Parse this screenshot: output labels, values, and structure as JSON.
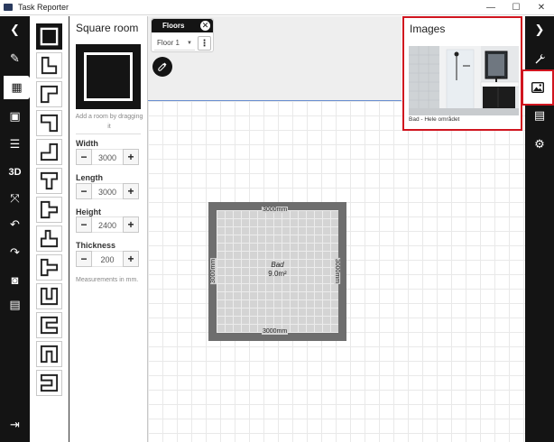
{
  "window": {
    "title": "Task Reporter",
    "controls": {
      "minimize": "—",
      "maximize": "☐",
      "close": "✕"
    }
  },
  "left_rail": {
    "items": [
      {
        "name": "back",
        "icon": "chevron-left-icon",
        "glyph": "❮"
      },
      {
        "name": "draw",
        "icon": "pencil-icon",
        "glyph": "✎"
      },
      {
        "name": "rooms",
        "icon": "grid-icon",
        "glyph": "▦",
        "active": true
      },
      {
        "name": "objects",
        "icon": "box-icon",
        "glyph": "▣"
      },
      {
        "name": "list",
        "icon": "list-icon",
        "glyph": "☰"
      },
      {
        "name": "view-3d",
        "label": "3D"
      },
      {
        "name": "fit",
        "icon": "expand-icon",
        "glyph": "⤧"
      },
      {
        "name": "undo",
        "icon": "undo-icon",
        "glyph": "↶"
      },
      {
        "name": "redo",
        "icon": "redo-icon",
        "glyph": "↷"
      },
      {
        "name": "snapshot",
        "icon": "camera-icon",
        "glyph": "◙"
      },
      {
        "name": "save",
        "icon": "save-icon",
        "glyph": "▤"
      },
      {
        "name": "exit",
        "icon": "exit-icon",
        "glyph": "⇥"
      }
    ]
  },
  "properties": {
    "title": "Square room",
    "drag_hint": "Add a room by dragging it",
    "fields": [
      {
        "label": "Width",
        "value": "3000"
      },
      {
        "label": "Length",
        "value": "3000"
      },
      {
        "label": "Height",
        "value": "2400"
      },
      {
        "label": "Thickness",
        "value": "200"
      }
    ],
    "minus": "−",
    "plus": "+",
    "note": "Measurements in mm."
  },
  "floors": {
    "title": "Floors",
    "close_glyph": "✕",
    "selected": "Floor 1",
    "caret": "▼",
    "menu_glyph": "⋮"
  },
  "room": {
    "name": "Bad",
    "area": "9.0m²",
    "dim_top": "3000mm",
    "dim_bottom": "3000mm",
    "dim_left": "3000mm",
    "dim_right": "3000mm"
  },
  "images_panel": {
    "title": "Images",
    "items": [
      {
        "caption": "Bad - Hele området"
      }
    ]
  },
  "right_rail": {
    "items": [
      {
        "name": "collapse",
        "icon": "chevron-right-icon",
        "glyph": "❯"
      },
      {
        "name": "tools",
        "icon": "wrench-icon",
        "glyph": "🔧"
      },
      {
        "name": "images",
        "icon": "image-icon",
        "active": true
      },
      {
        "name": "notes",
        "icon": "notes-icon",
        "glyph": "▤"
      },
      {
        "name": "settings",
        "icon": "gear-icon",
        "glyph": "⚙"
      }
    ]
  },
  "colors": {
    "rail": "#141414",
    "highlight": "#d0151f",
    "wall": "#6e6e6e",
    "floor": "#d4d4d4"
  }
}
